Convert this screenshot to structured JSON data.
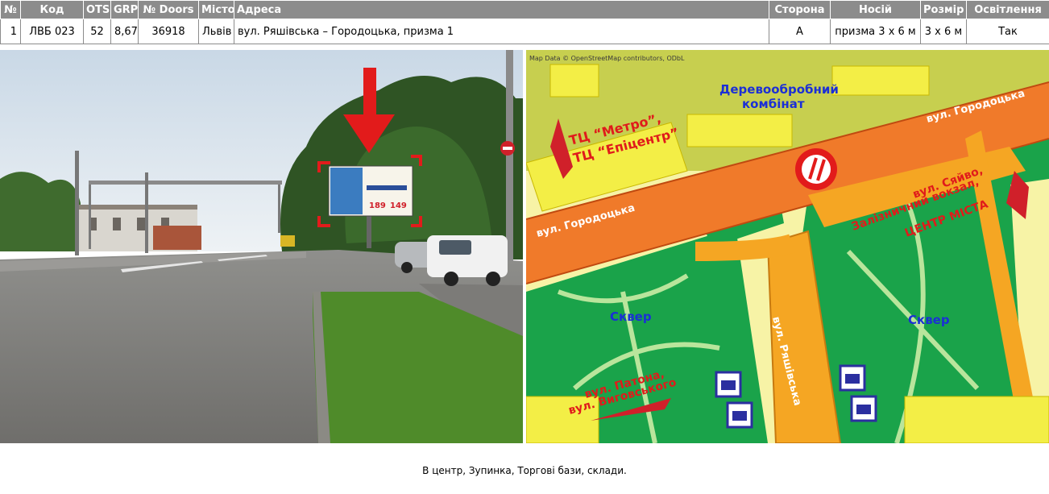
{
  "table": {
    "headers": [
      "№",
      "Код",
      "OTS",
      "GRP",
      "№ Doors",
      "Місто",
      "Адреса",
      "Сторона",
      "Носій",
      "Розмір",
      "Освітлення"
    ],
    "row": {
      "num": "1",
      "code": "ЛВБ 023",
      "ots": "52",
      "grp": "8,67",
      "doors": "36918",
      "city": "Львів",
      "address": "вул. Ряшівська – Городоцька, призма 1",
      "side": "А",
      "carrier": "призма 3 x 6 м",
      "size": "3 x 6 м",
      "lighting": "Так"
    }
  },
  "photo": {
    "billboard_price_left": "189",
    "billboard_price_right": "149"
  },
  "map": {
    "attribution": "Map Data © OpenStreetMap contributors, ODbL",
    "labels": {
      "factory_line1": "Деревообробний",
      "factory_line2": "комбінат",
      "gorodotska_upper": "вул. Городоцька",
      "gorodotska_lower": "вул. Городоцька",
      "tc_line1": "ТЦ “Метро”,",
      "tc_line2": "ТЦ “Епіцентр”",
      "siaivo_line1": "вул. Сяйво,",
      "siaivo_line2": "Залізничний вокзал,",
      "siaivo_line3": "ЦЕНТР МІСТА",
      "square_left": "Сквер",
      "square_right": "Сквер",
      "patona_line1": "вул. Патона,",
      "patona_line2": "вул. Виговського",
      "riashivska": "вул. Ряшівська"
    },
    "colors": {
      "road_main": "#f07a2a",
      "road_secondary": "#f5a623",
      "park": "#1aa34a",
      "building": "#f3ee46",
      "background": "#f7f3a6",
      "label_red": "#e01b1b",
      "label_blue": "#1b2fd6"
    }
  },
  "footer": {
    "text": "В центр, Зупинка, Торгові бази, склади."
  }
}
